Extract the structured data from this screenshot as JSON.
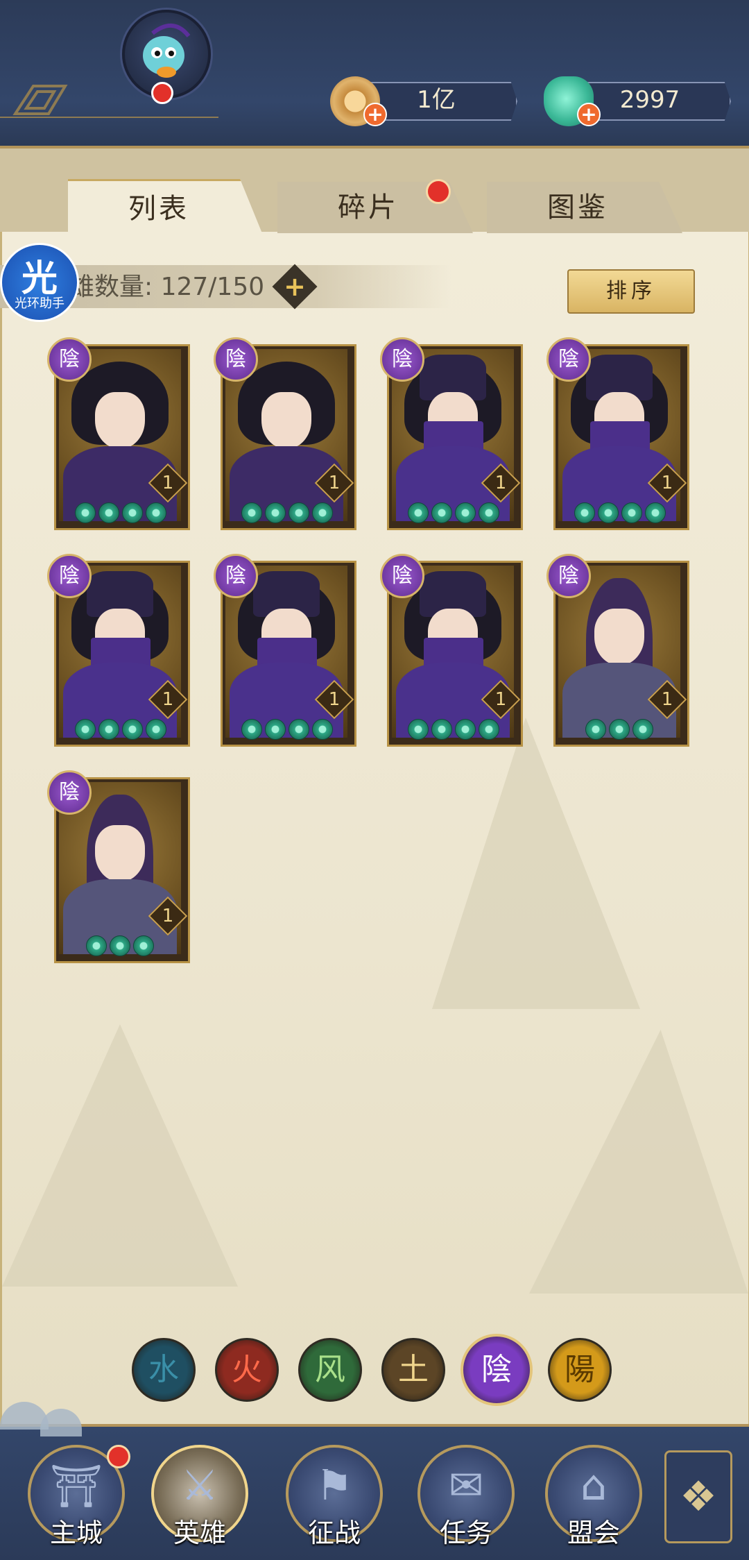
{
  "header": {
    "currency": {
      "coin_value": "1亿",
      "gem_value": "2997",
      "add_symbol": "+"
    }
  },
  "tabs": {
    "list": "列表",
    "fragments": "碎片",
    "atlas": "图鉴"
  },
  "hero_count": {
    "text": "雄数量: 127/150",
    "add_symbol": "+"
  },
  "sort_label": "排序",
  "helper": {
    "glyph": "光",
    "label": "光环助手"
  },
  "heroes": [
    {
      "element": "陰",
      "level": "1",
      "stars": 4,
      "type": "dark-swordsman"
    },
    {
      "element": "陰",
      "level": "1",
      "stars": 4,
      "type": "dark-swordsman"
    },
    {
      "element": "陰",
      "level": "1",
      "stars": 4,
      "type": "masked-blade"
    },
    {
      "element": "陰",
      "level": "1",
      "stars": 4,
      "type": "masked-blade"
    },
    {
      "element": "陰",
      "level": "1",
      "stars": 4,
      "type": "masked-blade"
    },
    {
      "element": "陰",
      "level": "1",
      "stars": 4,
      "type": "masked-blade"
    },
    {
      "element": "陰",
      "level": "1",
      "stars": 4,
      "type": "masked-blade"
    },
    {
      "element": "陰",
      "level": "1",
      "stars": 3,
      "type": "scholar"
    },
    {
      "element": "陰",
      "level": "1",
      "stars": 3,
      "type": "scholar"
    }
  ],
  "element_filters": [
    {
      "glyph": "水",
      "color": "#3a8fa8",
      "bg": "#1f4f62",
      "active": false
    },
    {
      "glyph": "火",
      "color": "#ff6a4a",
      "bg": "#8e2a20",
      "active": false
    },
    {
      "glyph": "风",
      "color": "#a9e08a",
      "bg": "#2f6a3a",
      "active": false
    },
    {
      "glyph": "土",
      "color": "#f0d58c",
      "bg": "#5c4526",
      "active": false
    },
    {
      "glyph": "陰",
      "color": "#ffffff",
      "bg": "#7a3cc0",
      "active": true
    },
    {
      "glyph": "陽",
      "color": "#5a3a00",
      "bg": "#d49a1a",
      "active": false
    }
  ],
  "bottom_nav": [
    {
      "label": "主城",
      "icon": "castle-icon",
      "active": false
    },
    {
      "label": "英雄",
      "icon": "hero-icon",
      "active": true
    },
    {
      "label": "征战",
      "icon": "battle-icon",
      "active": false
    },
    {
      "label": "任务",
      "icon": "scroll-icon",
      "active": false
    },
    {
      "label": "盟会",
      "icon": "guild-icon",
      "active": false
    }
  ],
  "colors": {
    "panel": "#f2ecd9",
    "gold": "#c8a961",
    "navy": "#2c3b58",
    "yin_purple": "#7a3cc0"
  }
}
